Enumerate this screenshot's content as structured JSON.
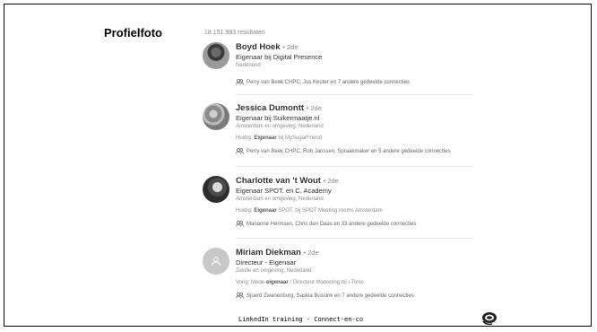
{
  "slide": {
    "title": "Profielfoto",
    "footer": "LinkedIn training - Connect-en-co"
  },
  "results": {
    "count": "18.151.993 resultaten",
    "items": [
      {
        "name": "Boyd Hoek",
        "degree": "• 2de",
        "headline": "Eigenaar bij Digital Presence",
        "location": "Nederland",
        "current_prefix": "",
        "current_bold": "",
        "current_rest": "",
        "shared": "Perry van Beek CHPC, Jos Keuter en 7 andere gedeelde connecties"
      },
      {
        "name": "Jessica Dumontt",
        "degree": "• 2de",
        "headline": "Eigenaar bij Suikermaatje.nl",
        "location": "Amsterdam en omgeving, Nederland",
        "current_prefix": "Huidig: ",
        "current_bold": "Eigenaar",
        "current_rest": " bij MySugarFriend",
        "shared": "Perry van Beek CHPC, Rob Janssen, Spraakmaker en 5 andere gedeelde connecties"
      },
      {
        "name": "Charlotte van 't Wout",
        "degree": "• 2de",
        "headline": "Eigenaar SPOT. en C. Academy",
        "location": "Amsterdam en omgeving, Nederland",
        "current_prefix": "Huidig: ",
        "current_bold": "Eigenaar",
        "current_rest": " SPOT. bij SPOT Meeting rooms Amsterdam",
        "shared": "Marianne Hermsen, Chris den Daas en 33 andere gedeelde connecties"
      },
      {
        "name": "Miriam Diekman",
        "degree": "• 2de",
        "headline": "Directeur - Eigenaar",
        "location": "Zwolle en omgeving, Nederland",
        "current_prefix": "Vorig: Mede-",
        "current_bold": "eigenaar",
        "current_rest": " / Directeur Marketing bij i-Tonic",
        "shared": "Sjoerd Zwanenburg, Saskia Bussink en 7 andere gedeelde connecties"
      }
    ]
  }
}
